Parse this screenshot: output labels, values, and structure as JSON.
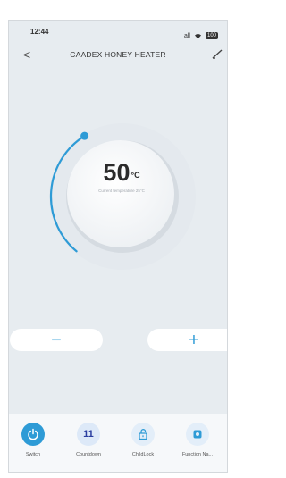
{
  "status": {
    "time": "12:44",
    "signal": "all",
    "battery": "100"
  },
  "header": {
    "title": "CAADEX HONEY HEATER",
    "back": "<"
  },
  "dial": {
    "temp_value": "50",
    "temp_unit": "°C",
    "current_label": "Current temperature 25°C",
    "level": 0.4
  },
  "controls": {
    "minus": "−",
    "plus": "+"
  },
  "toolbar": {
    "items": [
      {
        "label": "Switch",
        "icon": "power-icon"
      },
      {
        "label": "Countdown",
        "value": "11",
        "icon": "countdown-icon"
      },
      {
        "label": "ChildLock",
        "icon": "unlock-icon"
      },
      {
        "label": "Function Na...",
        "icon": "function-icon"
      }
    ]
  },
  "colors": {
    "accent": "#2e9bd6",
    "background": "#e7ecf0",
    "countdown": "#2b3ea0"
  }
}
